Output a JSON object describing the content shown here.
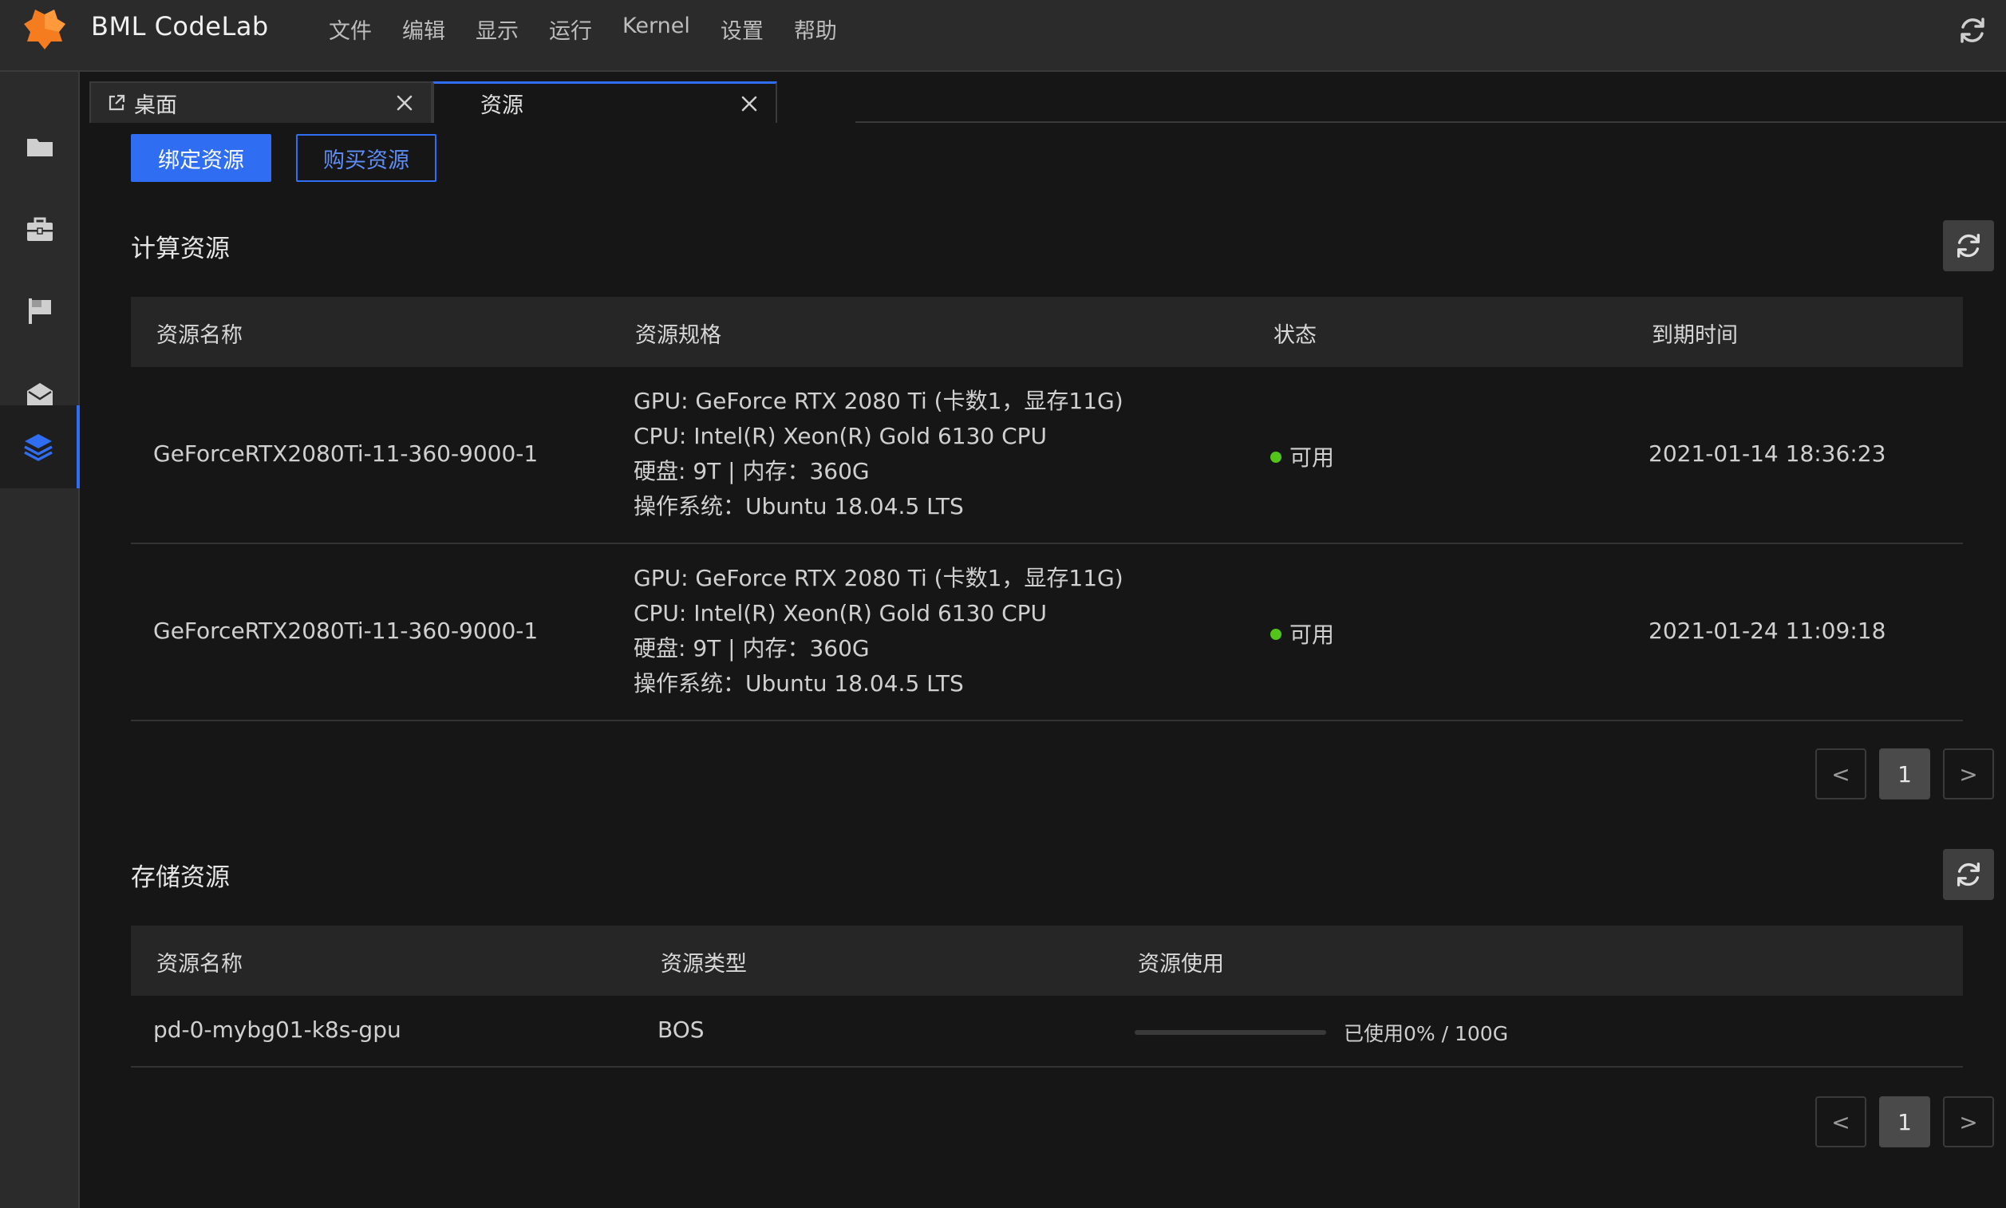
{
  "app": {
    "title": "BML CodeLab",
    "brand_color": "#f57c1f",
    "accent_color": "#2f6ef2"
  },
  "menu": [
    "文件",
    "编辑",
    "显示",
    "运行",
    "Kernel",
    "设置",
    "帮助"
  ],
  "sidebar": {
    "items": [
      {
        "icon": "folder-icon"
      },
      {
        "icon": "briefcase-icon"
      },
      {
        "icon": "flag-icon"
      },
      {
        "icon": "inbox-icon"
      },
      {
        "icon": "layers-icon",
        "active": true
      }
    ]
  },
  "tabs": [
    {
      "label": "桌面",
      "icon": "external-link-icon"
    },
    {
      "label": "资源",
      "active": true
    }
  ],
  "actions": {
    "bind_label": "绑定资源",
    "buy_label": "购买资源"
  },
  "compute": {
    "title": "计算资源",
    "headers": [
      "资源名称",
      "资源规格",
      "状态",
      "到期时间"
    ],
    "rows": [
      {
        "name": "GeForceRTX2080Ti-11-360-9000-1",
        "spec": [
          "GPU: GeForce RTX 2080 Ti (卡数1，显存11G)",
          "CPU: Intel(R) Xeon(R) Gold 6130 CPU",
          "硬盘: 9T   |   内存：360G",
          "操作系统：Ubuntu 18.04.5 LTS"
        ],
        "status": "可用",
        "expire": "2021-01-14 18:36:23"
      },
      {
        "name": "GeForceRTX2080Ti-11-360-9000-1",
        "spec": [
          "GPU: GeForce RTX 2080 Ti (卡数1，显存11G)",
          "CPU: Intel(R) Xeon(R) Gold 6130 CPU",
          "硬盘: 9T   |   内存：360G",
          "操作系统：Ubuntu 18.04.5 LTS"
        ],
        "status": "可用",
        "expire": "2021-01-24 11:09:18"
      }
    ],
    "pagination": {
      "prev": "<",
      "page": "1",
      "next": ">"
    }
  },
  "storage": {
    "title": "存储资源",
    "headers": [
      "资源名称",
      "资源类型",
      "资源使用"
    ],
    "rows": [
      {
        "name": "pd-0-mybg01-k8s-gpu",
        "type": "BOS",
        "usage_fraction": 0,
        "usage_label": "已使用0%   /   100G"
      }
    ],
    "pagination": {
      "prev": "<",
      "page": "1",
      "next": ">"
    }
  },
  "status_colors": {
    "available": "#52c41a"
  }
}
